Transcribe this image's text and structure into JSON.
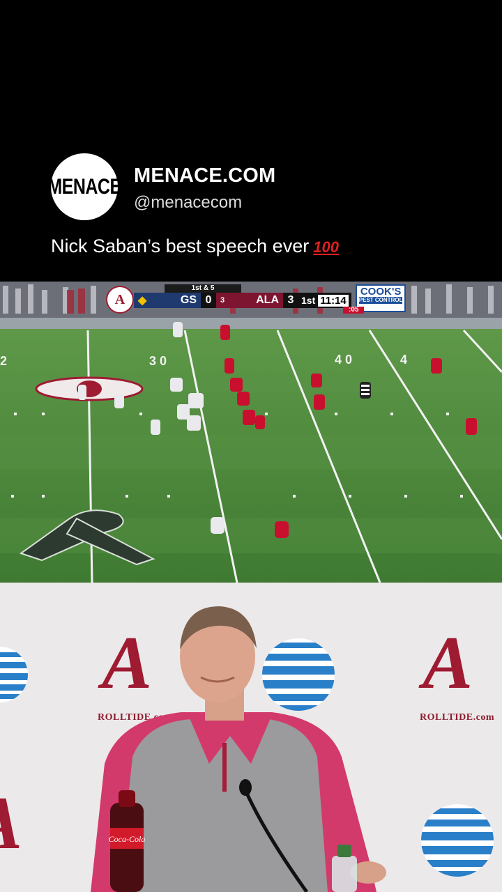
{
  "post": {
    "avatar_text": "MENACE",
    "display_name": "MENACE.COM",
    "handle": "@menacecom",
    "caption": "Nick Saban’s best speech ever",
    "caption_emoji": "100"
  },
  "scorebug": {
    "down_distance": "1st & 5",
    "home_logo": "A",
    "team1": "GS",
    "team1_score": "0",
    "team2_rank": "3",
    "team2": "ALA",
    "team2_score": "3",
    "quarter": "1st",
    "clock": "11:14",
    "play_clock": ":05",
    "sponsor": "COOK'S",
    "sponsor_sub": "PEST CONTROL"
  },
  "field": {
    "yard_numbers": [
      "2",
      "3 0",
      "4 0",
      "4"
    ]
  },
  "presser": {
    "logo_letter": "A",
    "backdrop_text": "ROLLTIDE.com",
    "bottle_label": "Coca-Cola"
  },
  "colors": {
    "crimson": "#9e1b32",
    "field_green": "#4f8a3c",
    "att_blue": "#2a7fc9"
  }
}
